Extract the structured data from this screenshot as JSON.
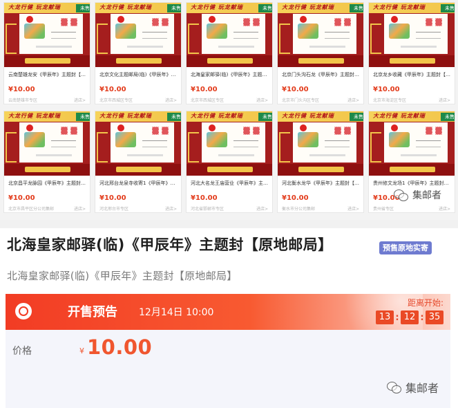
{
  "grid": {
    "cards": [
      {
        "title": "云南楚雄龙安《甲辰年》主题封【原...",
        "price": "¥10.00",
        "location": "云南楚雄市专区",
        "enter": "进店>",
        "slogan": "大龙行健  玩龙献瑞",
        "badge": "未售"
      },
      {
        "title": "北京文化主题邮局(临)《甲辰年》主...",
        "price": "¥10.00",
        "location": "北京市西城区专区",
        "enter": "进店>",
        "slogan": "大龙行健  玩龙献瑞",
        "badge": "未售"
      },
      {
        "title": "北海皇家邮驿(临)《甲辰年》主题封...",
        "price": "¥10.00",
        "location": "北京市西城区专区",
        "enter": "进店>",
        "slogan": "大龙行健  玩龙献瑞",
        "badge": "未售"
      },
      {
        "title": "北京门头沟石龙《甲辰年》主题封【...",
        "price": "¥10.00",
        "location": "北京市门头沟区专区",
        "enter": "进店>",
        "slogan": "大龙行健  玩龙献瑞",
        "badge": "未售"
      },
      {
        "title": "北京龙乡收藏《甲辰年》主题封【原...",
        "price": "¥10.00",
        "location": "北京市海淀区专区",
        "enter": "进店>",
        "slogan": "大龙行健  玩龙献瑞",
        "badge": "未售"
      },
      {
        "title": "北京昌平龙脉园《甲辰年》主题封【...",
        "price": "¥10.00",
        "location": "北京市昌平区分公司集邮",
        "enter": "进店>",
        "slogan": "大龙行健  玩龙献瑞",
        "badge": "未售"
      },
      {
        "title": "河北邢台龙泉寺收寄1《甲辰年》主...",
        "price": "¥10.00",
        "location": "河北邢台市专区",
        "enter": "进店>",
        "slogan": "大龙行健  玩龙献瑞",
        "badge": "未售"
      },
      {
        "title": "河北大名龙王庙营业《甲辰年》主题...",
        "price": "¥10.00",
        "location": "河北省邯郸市专区",
        "enter": "进店>",
        "slogan": "大龙行健  玩龙献瑞",
        "badge": "未售"
      },
      {
        "title": "河北衡水龙华《甲辰年》主题封【原...",
        "price": "¥10.00",
        "location": "衡水市分公司集邮",
        "enter": "进店>",
        "slogan": "大龙行健  玩龙献瑞",
        "badge": "未售"
      },
      {
        "title": "贵州修文龙场1《甲辰年》主题封【...",
        "price": "¥10.00",
        "location": "贵州省专区",
        "enter": "进店>",
        "slogan": "大龙行健  玩龙献瑞",
        "badge": "未售"
      }
    ]
  },
  "watermark": {
    "text": "集邮者"
  },
  "detail": {
    "title": "北海皇家邮驿(临)《甲辰年》主题封【原地邮局】",
    "badge": "预售原地实寄",
    "subtitle": "北海皇家邮驿(临)《甲辰年》主题封【原地邮局】",
    "banner": {
      "label": "开售预告",
      "date": "12月14日 10:00",
      "countdown_label": "距离开始:",
      "hours": "13",
      "minutes": "12",
      "seconds": "35"
    },
    "price_label": "价格",
    "currency": "¥",
    "price": "10.00"
  },
  "colors": {
    "accent": "#f0562f",
    "badge": "#6e7bd0",
    "sold_ribbon": "#1d8a4a",
    "thumb_red": "#a51e1e"
  }
}
